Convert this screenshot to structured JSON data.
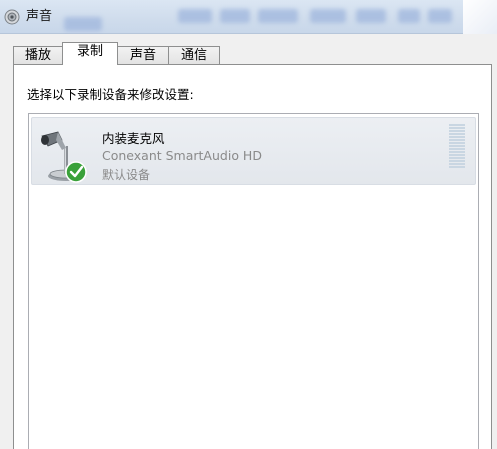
{
  "window": {
    "title": "声音",
    "icon": "speaker-icon"
  },
  "tabs": [
    {
      "label": "播放",
      "active": false
    },
    {
      "label": "录制",
      "active": true
    },
    {
      "label": "声音",
      "active": false
    },
    {
      "label": "通信",
      "active": false
    }
  ],
  "recording": {
    "instruction": "选择以下录制设备来修改设置:",
    "devices": [
      {
        "name": "内装麦克风",
        "driver": "Conexant SmartAudio HD",
        "status": "默认设备",
        "icon": "microphone-icon",
        "badge": "default-check-icon"
      }
    ]
  },
  "colors": {
    "selection_bg": "#e6e9ee",
    "check_green": "#3aa13a",
    "meter": "#c9d6e2"
  }
}
